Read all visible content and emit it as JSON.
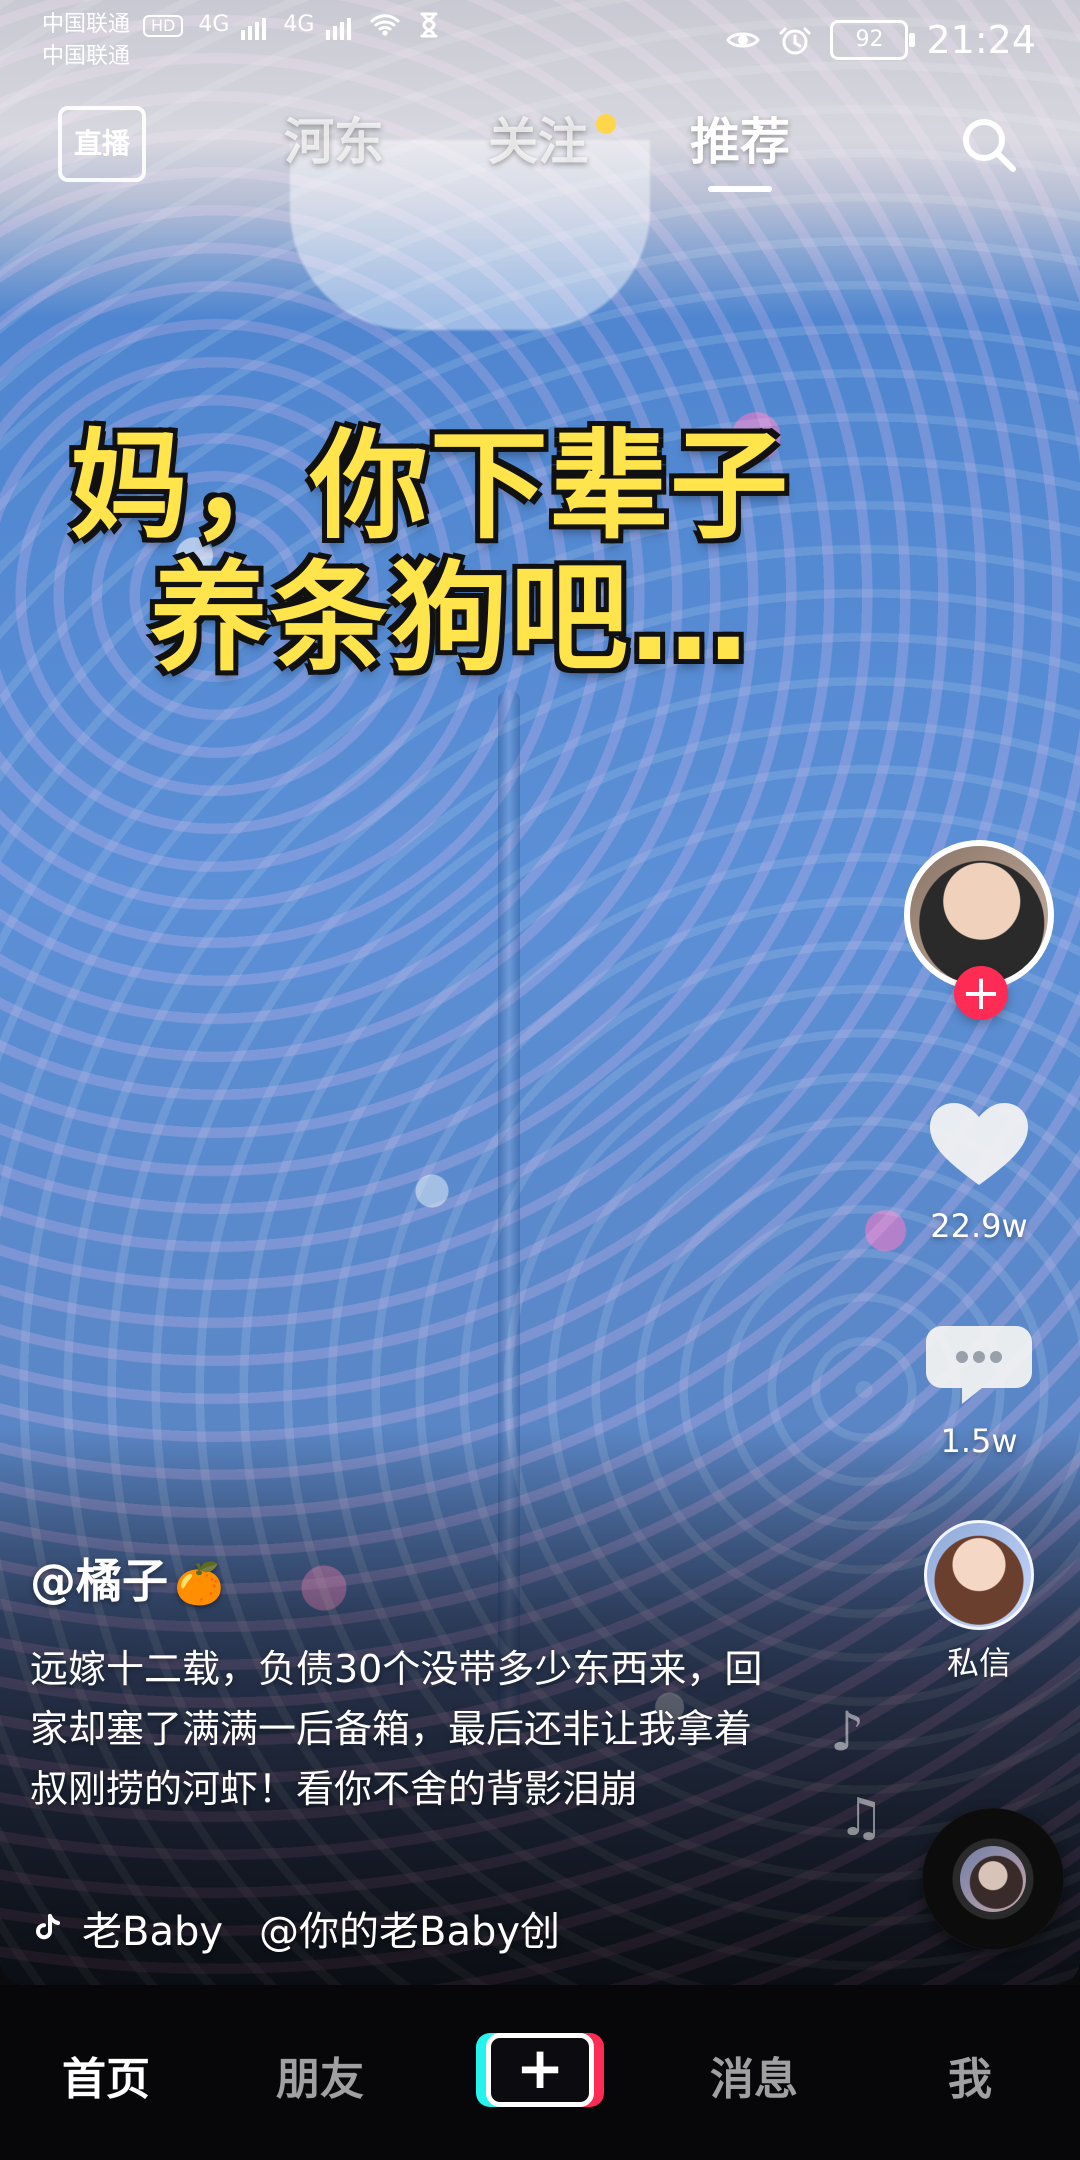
{
  "status_bar": {
    "carrier_line1": "中国联通",
    "carrier_line2": "中国联通",
    "hd": "HD",
    "net1": "4G",
    "net2": "4G",
    "battery": "92",
    "time": "21:24"
  },
  "top_nav": {
    "live_label": "直播",
    "tabs": [
      {
        "label": "河东"
      },
      {
        "label": "关注"
      },
      {
        "label": "推荐"
      }
    ]
  },
  "video_caption": {
    "line1": "妈，你下辈子",
    "line2": "养条狗吧…"
  },
  "right_actions": {
    "likes": "22.9w",
    "comments": "1.5w",
    "dm_label": "私信"
  },
  "post": {
    "author": "@橘子",
    "author_emoji": "🍊",
    "description": "远嫁十二载，负债30个没带多少东西来，回家却塞了满满一后备箱，最后还非让我拿着叔刚捞的河虾！看你不舍的背影泪崩",
    "music_song": "老Baby",
    "music_creator": "@你的老Baby创"
  },
  "bottom_tabs": [
    {
      "label": "首页"
    },
    {
      "label": "朋友"
    },
    {
      "label": "消息"
    },
    {
      "label": "我"
    }
  ],
  "icons": {
    "search": "search-icon",
    "heart": "heart-icon",
    "comment": "comment-icon",
    "tiktok": "tiktok-icon",
    "music": "music-note-icon",
    "plus": "plus-icon"
  },
  "colors": {
    "accent_pink": "#fe2c55",
    "accent_cyan": "#25f4ee",
    "caption_yellow": "#ffe54b"
  }
}
